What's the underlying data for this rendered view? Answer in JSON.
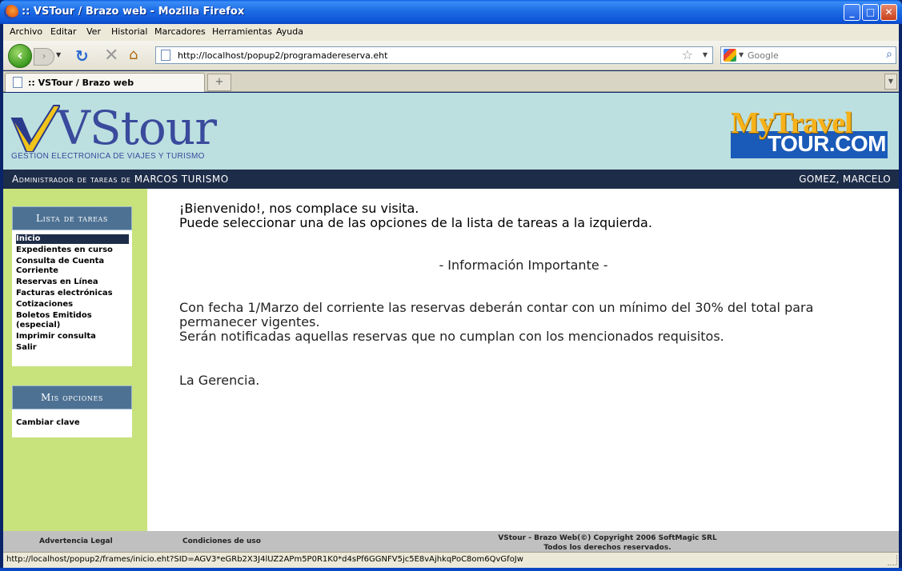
{
  "window": {
    "title": ":: VSTour / Brazo web - Mozilla Firefox"
  },
  "menu": [
    "Archivo",
    "Editar",
    "Ver",
    "Historial",
    "Marcadores",
    "Herramientas",
    "Ayuda"
  ],
  "nav": {
    "url": "http://localhost/popup2/programadereserva.eht",
    "search_placeholder": "Google"
  },
  "tab": {
    "label": ":: VSTour / Brazo web",
    "new_tab": "+"
  },
  "header": {
    "logo_text": "VStour",
    "logo_tagline": "GESTION ELECTRONICA DE VIAJES Y TURISMO",
    "brand_top": "MyTravel",
    "brand_bottom": "TOUR.COM"
  },
  "darkbar": {
    "left": "Administrador de tareas de MARCOS TURISMO",
    "right": "GOMEZ, MARCELO"
  },
  "tasks": {
    "title": "Lista de tareas",
    "items": [
      "Inicio",
      "Expedientes en curso",
      "Consulta de Cuenta Corriente",
      "Reservas en Línea",
      "Facturas electrónicas",
      "Cotizaciones",
      "Boletos Emitidos (especial)",
      "Imprimir consulta",
      "Salir"
    ]
  },
  "options": {
    "title": "Mis opciones",
    "items": [
      "Cambiar clave"
    ]
  },
  "content": {
    "welcome": "¡Bienvenido!, nos complace su visita.",
    "instructions": "Puede seleccionar una de las opciones de la lista de tareas a la izquierda.",
    "info_title": "- Información Importante -",
    "notice1": "Con fecha 1/Marzo del corriente las reservas deberán contar con un mínimo del 30% del total para permanecer vigentes.",
    "notice2": "Serán notificadas aquellas reservas que no cumplan con los mencionados requisitos.",
    "signature": "La Gerencia."
  },
  "footer": {
    "legal": "Advertencia Legal",
    "terms": "Condiciones de uso",
    "copyright": "VStour - Brazo Web(©) Copyright 2006 SoftMagic SRL",
    "rights": "Todos los derechos reservados."
  },
  "status": {
    "text": "http://localhost/popup2/frames/inicio.eht?SID=AGV3*eGRb2X3J4lUZ2APm5P0R1K0*d4sPf6GGNFV5jc5E8vAjhkqPoC8om6QvGfoJw"
  }
}
